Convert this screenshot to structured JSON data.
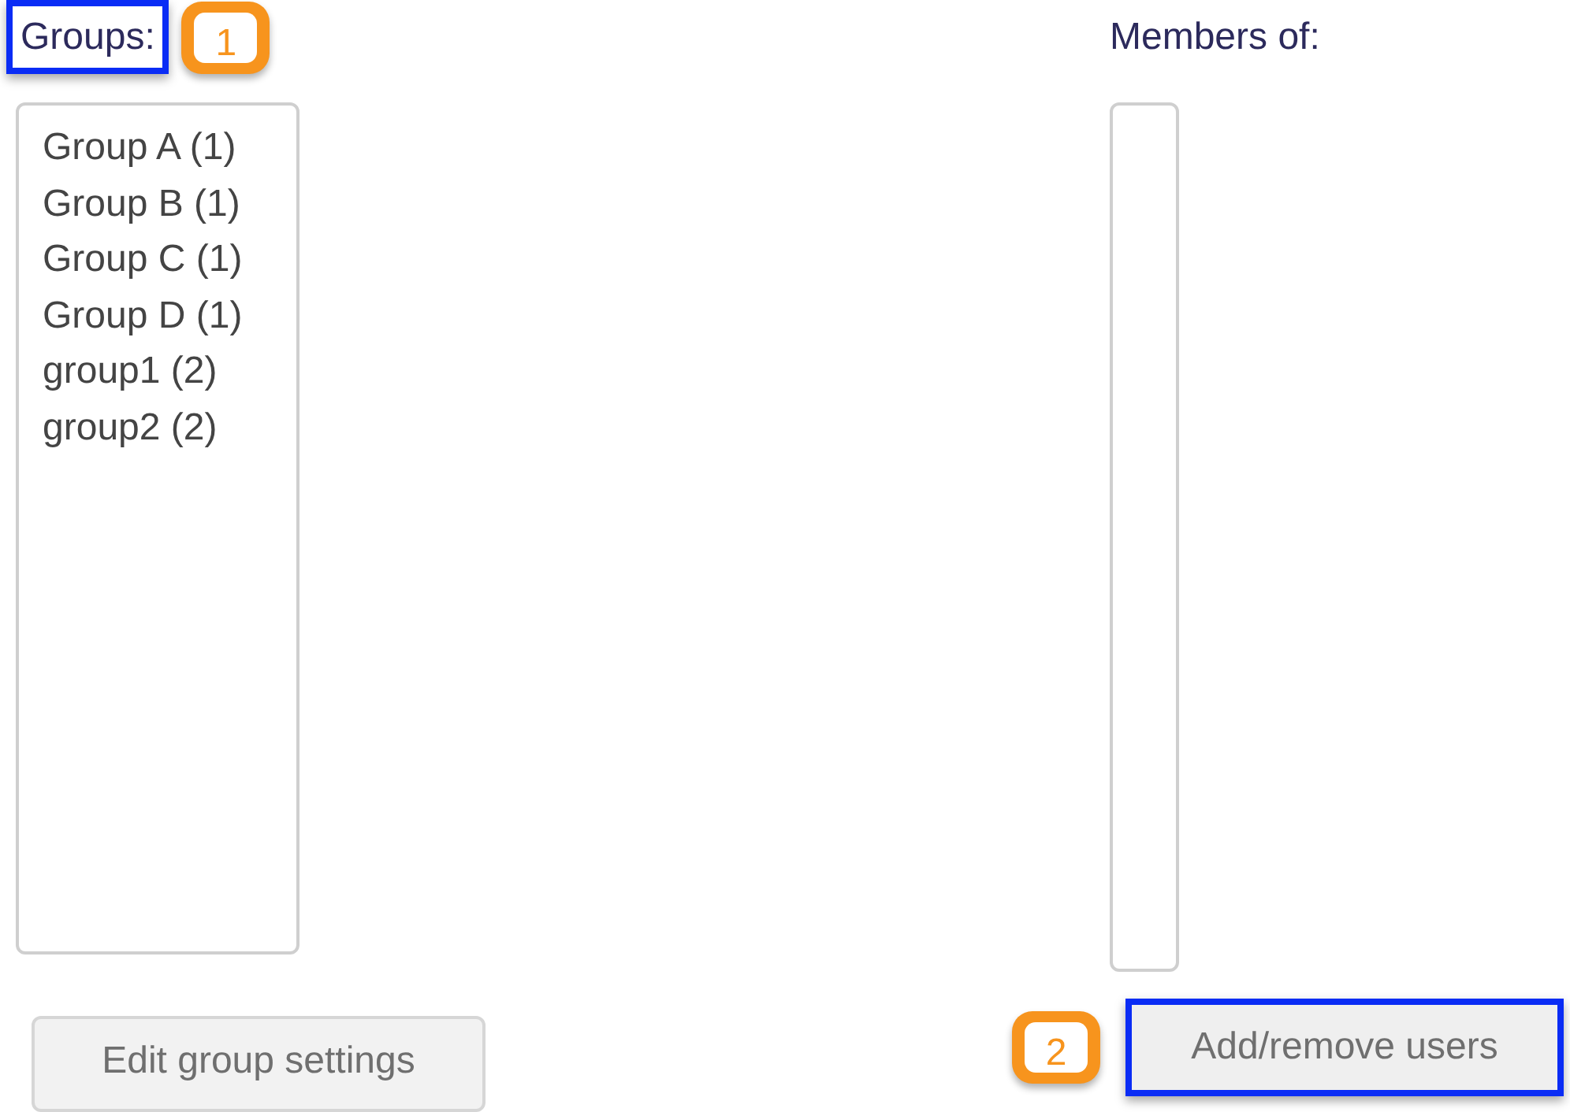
{
  "groups": {
    "label": "Groups:",
    "highlighted": true,
    "callout": "1",
    "items": [
      {
        "text": "Group A (1)",
        "selected": false
      },
      {
        "text": "Group B (1)",
        "selected": false
      },
      {
        "text": "Group C (1)",
        "selected": false
      },
      {
        "text": "Group D (1)",
        "selected": false
      },
      {
        "text": "group1 (2)",
        "selected": false
      },
      {
        "text": "group2 (2)",
        "selected": false
      }
    ],
    "button": {
      "label": "Edit group settings",
      "highlighted": false
    }
  },
  "members": {
    "label": "Members of:",
    "button": {
      "label": "Add/remove users",
      "highlighted": true,
      "callout": "2"
    }
  }
}
